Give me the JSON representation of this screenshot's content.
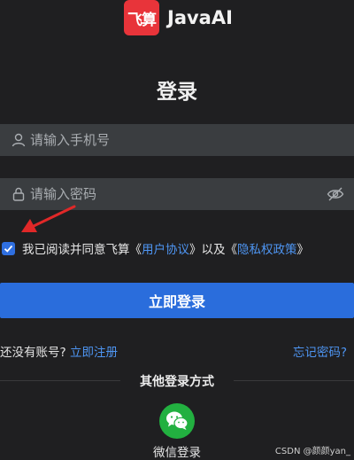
{
  "header": {
    "logo_text": "飞算",
    "app_name": "JavaAI",
    "page_title": "登录"
  },
  "form": {
    "phone_placeholder": "请输入手机号",
    "password_placeholder": "请输入密码",
    "agreement": {
      "prefix": "我已阅读并同意飞算《",
      "user_agreement": "用户协议",
      "middle": "》以及《",
      "privacy_policy": "隐私权政策",
      "suffix": "》",
      "checked": true
    },
    "login_button": "立即登录"
  },
  "footer": {
    "no_account": "还没有账号?",
    "register": "立即注册",
    "forgot_password": "忘记密码?",
    "other_login_title": "其他登录方式",
    "wechat_label": "微信登录"
  },
  "watermark": "CSDN @颜颜yan_",
  "colors": {
    "background": "#1f1f21",
    "field": "#3a3d40",
    "primary": "#2a6ddc",
    "link": "#4e95f2",
    "logo": "#e8343a",
    "wechat": "#22b040",
    "annotation_arrow": "#e02828"
  }
}
